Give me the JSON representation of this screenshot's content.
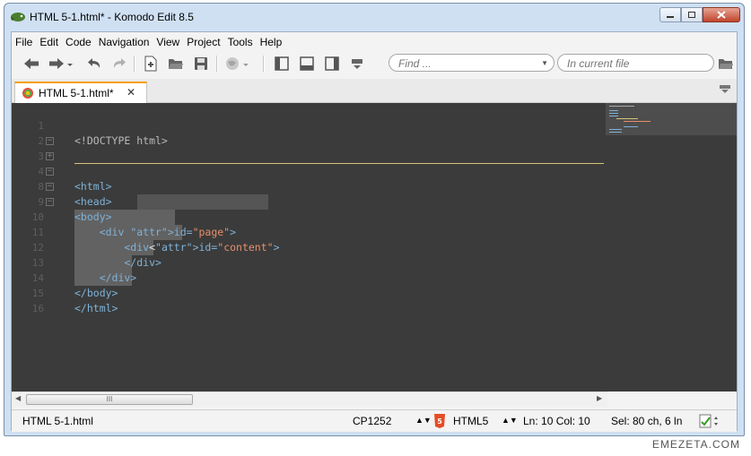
{
  "window": {
    "title": "HTML 5-1.html* - Komodo Edit 8.5"
  },
  "menu": [
    "File",
    "Edit",
    "Code",
    "Navigation",
    "View",
    "Project",
    "Tools",
    "Help"
  ],
  "search": {
    "find_placeholder": "Find ...",
    "scope_placeholder": "In current file"
  },
  "tab": {
    "label": "HTML 5-1.html*",
    "close": "✕"
  },
  "editor": {
    "lines": [
      {
        "n": "1",
        "text": "<!DOCTYPE html>"
      },
      {
        "n": "2",
        "text": ""
      },
      {
        "n": "3",
        "text": "<html>"
      },
      {
        "n": "4",
        "text": "<head>"
      },
      {
        "n": "8",
        "text": "<body>"
      },
      {
        "n": "9",
        "text": "    <div id=\"page\">"
      },
      {
        "n": "10",
        "text": "        <div id=\"content\">"
      },
      {
        "n": "11",
        "text": "            <"
      },
      {
        "n": "12",
        "text": "        </div>"
      },
      {
        "n": "13",
        "text": "    </div>"
      },
      {
        "n": "14",
        "text": "</body>"
      },
      {
        "n": "15",
        "text": "</html>"
      },
      {
        "n": "16",
        "text": ""
      }
    ]
  },
  "scrollbar": {
    "thumb_grip": "III"
  },
  "status": {
    "filename": "HTML 5-1.html",
    "encoding": "CP1252",
    "language": "HTML5",
    "position": "Ln: 10 Col: 10",
    "selection": "Sel: 80 ch, 6 ln"
  },
  "watermark": "EMEZETA.COM"
}
